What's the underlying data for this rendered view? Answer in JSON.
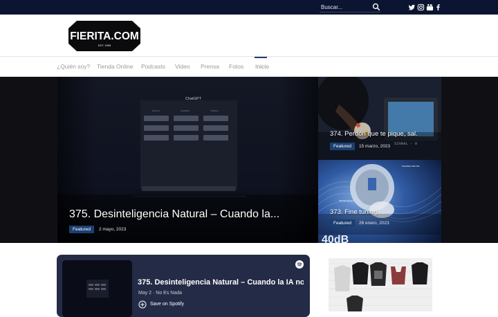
{
  "topbar": {
    "search": {
      "placeholder": "Buscar..."
    },
    "social": [
      "twitter-icon",
      "instagram-icon",
      "youtube-icon",
      "facebook-icon"
    ]
  },
  "header": {
    "logo_text": "FIERITA.COM",
    "logo_subtext": "EST. 1999"
  },
  "nav": {
    "items": [
      {
        "label": "¿Quién soy?"
      },
      {
        "label": "Tienda Online"
      },
      {
        "label": "Podcasts"
      },
      {
        "label": "Video"
      },
      {
        "label": "Prensa"
      },
      {
        "label": "Fotos"
      },
      {
        "label": "Inicio",
        "active": true
      }
    ]
  },
  "hero": {
    "main": {
      "title": "375. Desinteligencia Natural – Cuando la...",
      "badge": "Featured",
      "date": "2 mayo, 2023",
      "screen_title": "ChatGPT",
      "columns": [
        "Examples",
        "Capabilities",
        "Limitations"
      ]
    },
    "side_top": {
      "title": "374. Perdón que te pique, sal.",
      "badge": "Featured",
      "date": "15 marzo, 2023",
      "screen_text": "SIGNAL  - 0"
    },
    "side_bottom": {
      "title": "373. Fine tuning",
      "badge": "Featured",
      "date": "26 enero, 2023",
      "overlay_text": "40dB",
      "annotation_1": "Feedback ANC Mic",
      "annotation_2": "Talk Microphone"
    }
  },
  "spotify": {
    "title": "375. Desinteligencia Natural – Cuando la IA no",
    "meta": "May 2 · No Es Nada",
    "save_label": "Save on Spotify"
  },
  "colors": {
    "topbar": "#0b1430",
    "badge": "#1c3f72",
    "spotify_bg": "#242b46"
  }
}
